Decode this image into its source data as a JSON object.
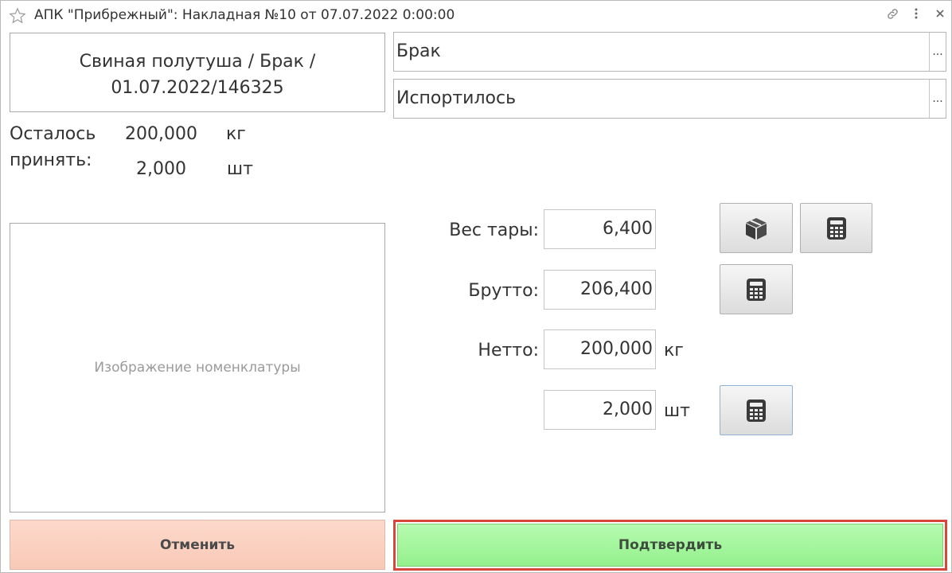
{
  "window": {
    "title": "АПК \"Прибрежный\": Накладная №10 от 07.07.2022 0:00:00",
    "icons": [
      "star-icon",
      "link-icon",
      "more-icon",
      "close-icon"
    ]
  },
  "product": {
    "line1": "Свиная полутуша / Брак /",
    "line2": "01.07.2022/146325"
  },
  "remaining": {
    "label_line1": "Осталось",
    "label_line2": "принять:",
    "kg_value": "200,000",
    "kg_unit": "кг",
    "pcs_value": "2,000",
    "pcs_unit": "шт"
  },
  "fields": {
    "quality": {
      "value": "Брак",
      "button": "..."
    },
    "reason": {
      "value": "Испортилось",
      "button": "..."
    }
  },
  "image_placeholder": "Изображение номенклатуры",
  "weights": {
    "tare_label": "Вес тары:",
    "tare_value": "6,400",
    "gross_label": "Брутто:",
    "gross_value": "206,400",
    "net_label": "Нетто:",
    "net_value": "200,000",
    "net_unit": "кг",
    "pcs_value": "2,000",
    "pcs_unit": "шт"
  },
  "actions": {
    "cancel": "Отменить",
    "confirm": "Подтвердить"
  },
  "colors": {
    "cancel_bg": "#fbcfbf",
    "confirm_bg": "#a4f59d",
    "confirm_highlight": "#d6463b"
  }
}
